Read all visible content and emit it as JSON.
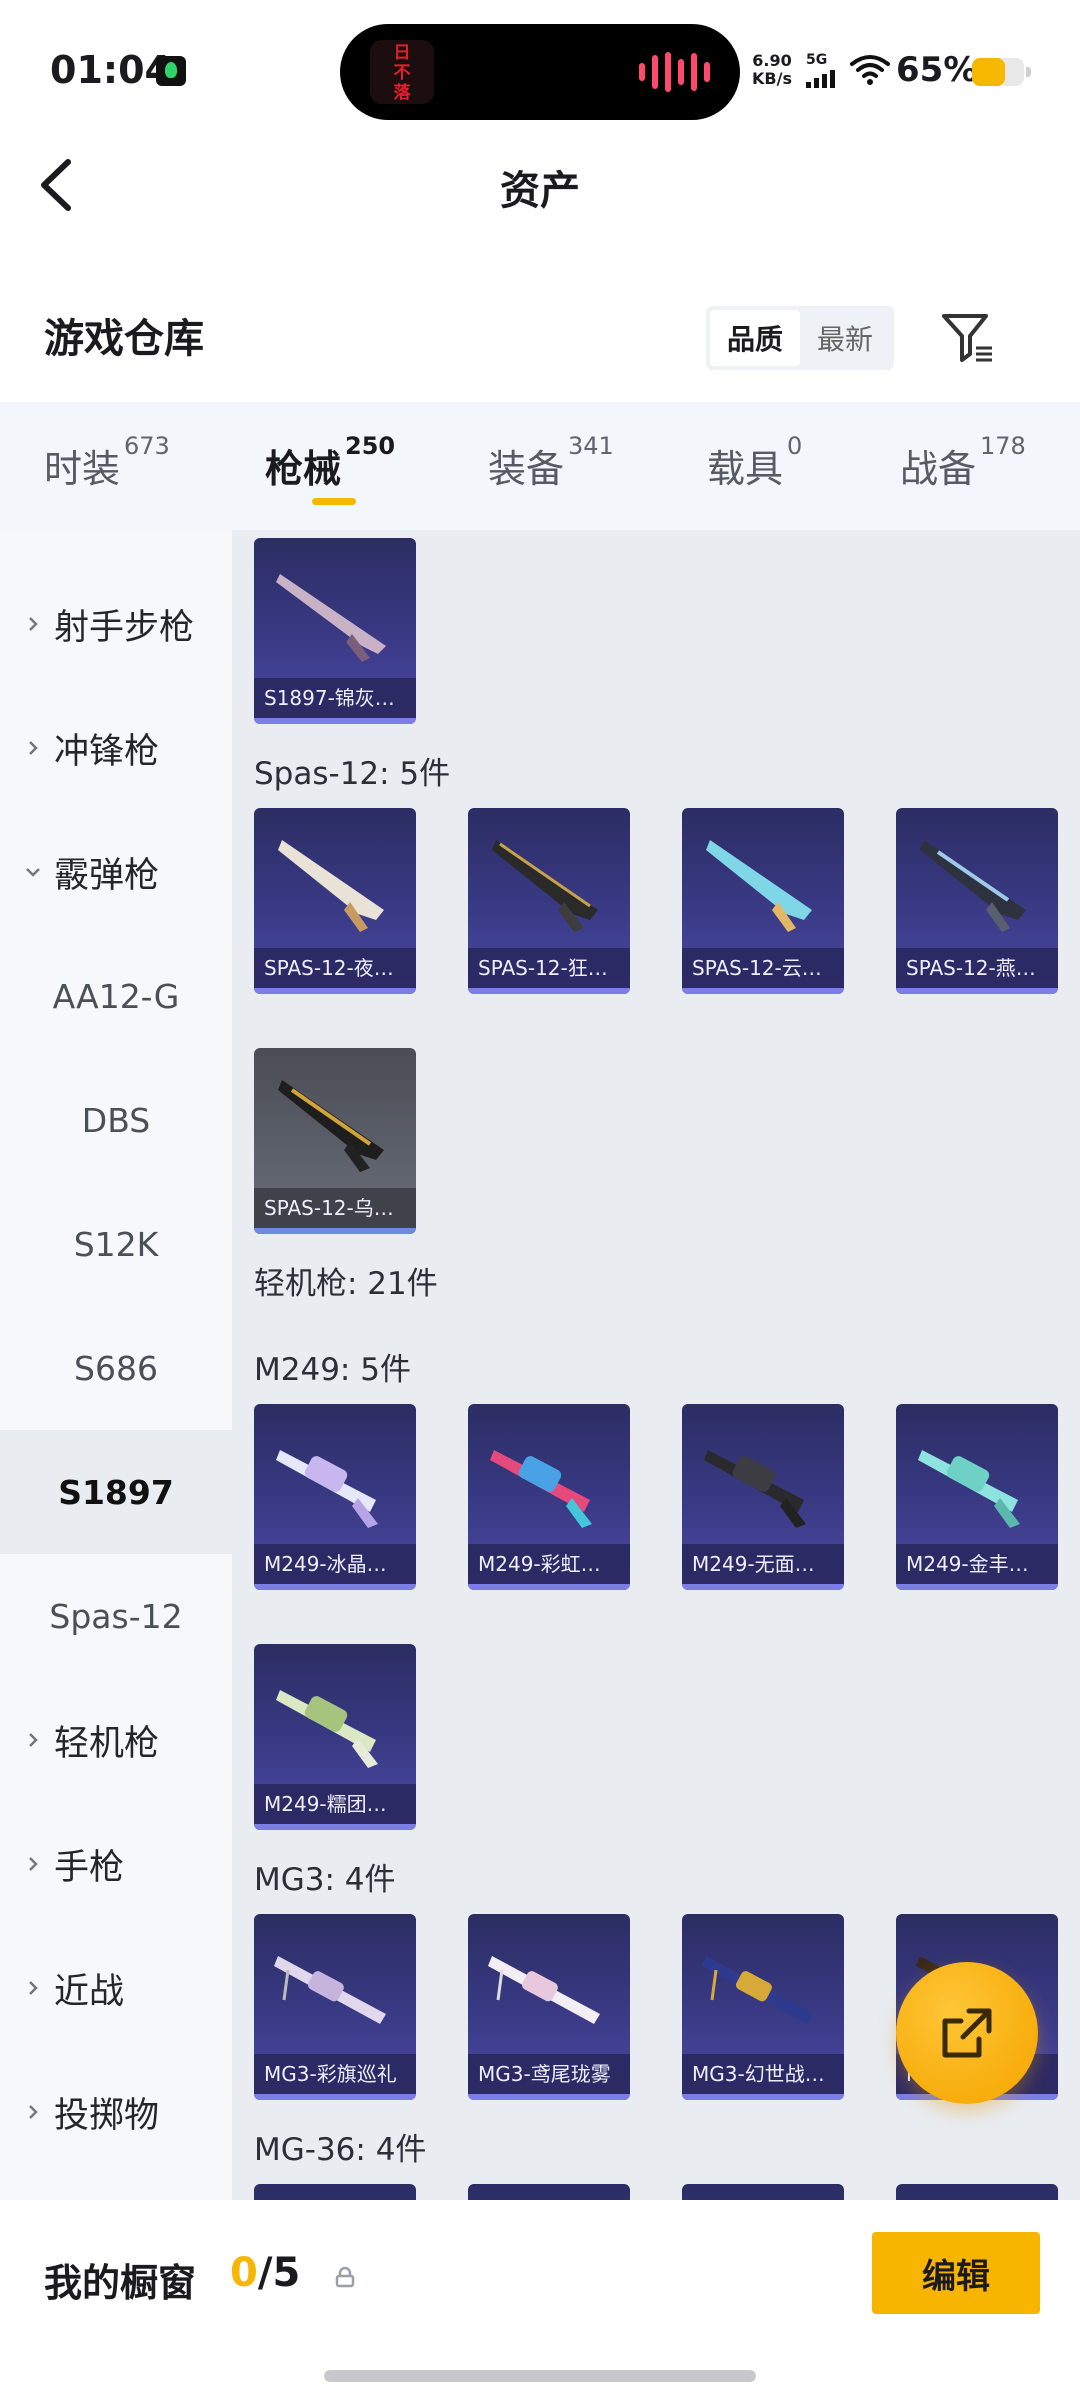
{
  "status_bar": {
    "time": "01:04",
    "net_speed_value": "6.90",
    "net_speed_unit": "KB/s",
    "network": "5G",
    "battery": "65%",
    "island_art_text": "日不落"
  },
  "header": {
    "title": "资产"
  },
  "warehouse": {
    "title": "游戏仓库",
    "sort_options": [
      "品质",
      "最新"
    ],
    "sort_selected": "品质"
  },
  "tabs": [
    {
      "label": "时装",
      "count": "673"
    },
    {
      "label": "枪械",
      "count": "250"
    },
    {
      "label": "装备",
      "count": "341"
    },
    {
      "label": "载具",
      "count": "0"
    },
    {
      "label": "战备",
      "count": "178"
    }
  ],
  "sidebar": {
    "items": [
      {
        "label": "射手步枪",
        "kind": "group"
      },
      {
        "label": "冲锋枪",
        "kind": "group"
      },
      {
        "label": "霰弹枪",
        "kind": "group-open"
      },
      {
        "label": "AA12-G",
        "kind": "sub"
      },
      {
        "label": "DBS",
        "kind": "sub"
      },
      {
        "label": "S12K",
        "kind": "sub"
      },
      {
        "label": "S686",
        "kind": "sub"
      },
      {
        "label": "S1897",
        "kind": "sub-selected"
      },
      {
        "label": "Spas-12",
        "kind": "sub"
      },
      {
        "label": "轻机枪",
        "kind": "group"
      },
      {
        "label": "手枪",
        "kind": "group"
      },
      {
        "label": "近战",
        "kind": "group"
      },
      {
        "label": "投掷物",
        "kind": "group"
      }
    ]
  },
  "content": {
    "s1897_items": [
      "S1897-锦灰…"
    ],
    "spas_label": "Spas-12: 5件",
    "spas_items": [
      "SPAS-12-夜…",
      "SPAS-12-狂…",
      "SPAS-12-云…",
      "SPAS-12-燕…",
      "SPAS-12-乌…"
    ],
    "lmg_label": "轻机枪: 21件",
    "m249_label": "M249: 5件",
    "m249_items": [
      "M249-冰晶…",
      "M249-彩虹…",
      "M249-无面…",
      "M249-金丰…",
      "M249-糯团…"
    ],
    "mg3_label": "MG3: 4件",
    "mg3_items": [
      "MG3-彩旗巡礼",
      "MG3-鸢尾珑雾",
      "MG3-幻世战…",
      "MG3-…纹"
    ],
    "mg36_label": "MG-36: 4件"
  },
  "bottom_bar": {
    "showcase_label": "我的橱窗",
    "showcase_current": "0",
    "showcase_total": "/5",
    "edit_label": "编辑"
  },
  "colors": {
    "accent": "#f5b700",
    "card_purple": "#3a3a86",
    "card_gray": "#5d616b"
  }
}
